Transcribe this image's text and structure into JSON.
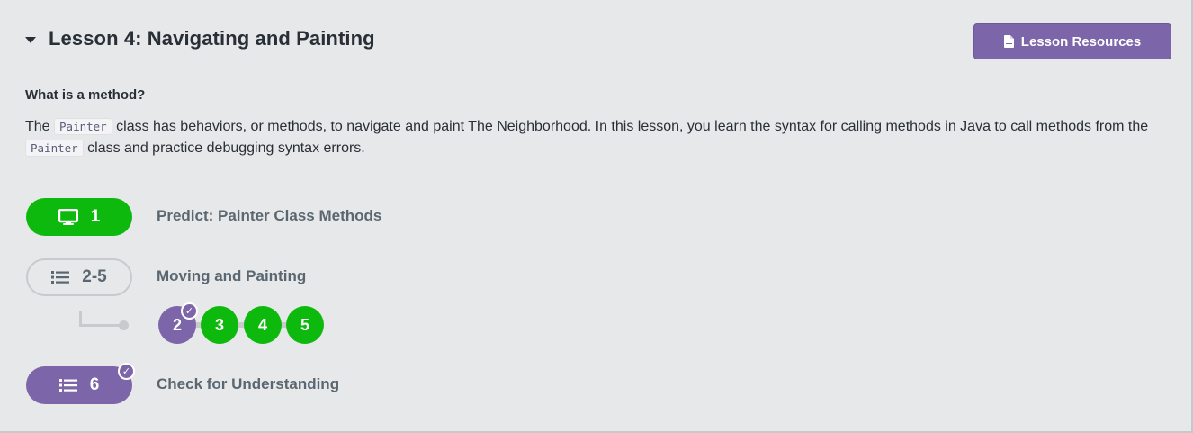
{
  "lesson": {
    "title": "Lesson 4: Navigating and Painting",
    "resources_label": "Lesson Resources",
    "subheading": "What is a method?",
    "description": {
      "part1": "The ",
      "code1": "Painter",
      "part2": " class has behaviors, or methods, to navigate and paint The Neighborhood. In this lesson, you learn the syntax for calling methods in Java to call methods from the ",
      "code2": "Painter",
      "part3": " class and practice debugging syntax errors."
    }
  },
  "levels": [
    {
      "pill_label": "1",
      "name": "Predict: Painter Class Methods",
      "status": "green",
      "icon": "monitor-icon"
    },
    {
      "pill_label": "2-5",
      "name": "Moving and Painting",
      "status": "outline",
      "icon": "list-icon",
      "bubbles": [
        {
          "label": "2",
          "status": "purple",
          "checked": true
        },
        {
          "label": "3",
          "status": "green",
          "checked": false
        },
        {
          "label": "4",
          "status": "green",
          "checked": false
        },
        {
          "label": "5",
          "status": "green",
          "checked": false
        }
      ]
    },
    {
      "pill_label": "6",
      "name": "Check for Understanding",
      "status": "purple",
      "icon": "list-icon",
      "checked": true
    }
  ],
  "colors": {
    "green": "#0eb90e",
    "purple": "#7c65a8",
    "background": "#e7e8ea",
    "muted_text": "#5b6770"
  }
}
